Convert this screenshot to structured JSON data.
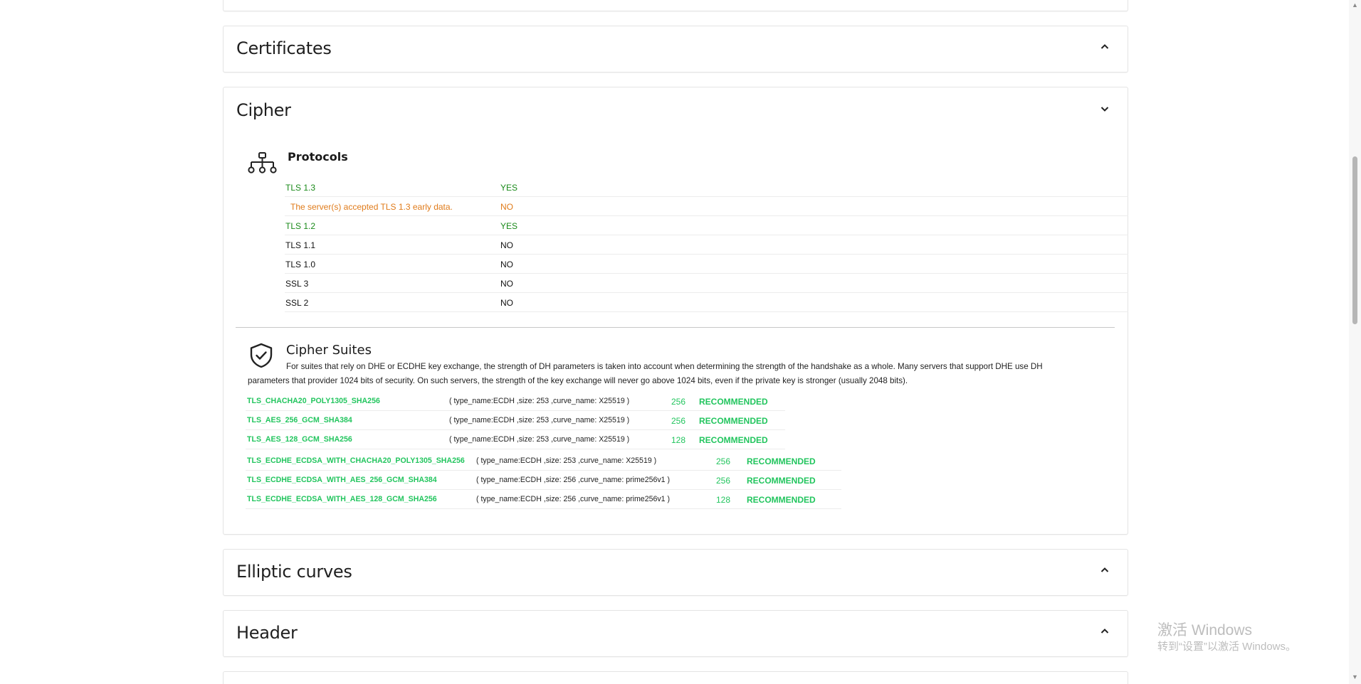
{
  "sections": {
    "certificates": {
      "title": "Certificates"
    },
    "cipher": {
      "title": "Cipher"
    },
    "elliptic_curves": {
      "title": "Elliptic curves"
    },
    "header": {
      "title": "Header"
    }
  },
  "protocols": {
    "title": "Protocols",
    "rows": [
      {
        "name": "TLS 1.3",
        "value": "YES",
        "color": "#1a8a1a"
      },
      {
        "name": "The server(s) accepted TLS 1.3 early data.",
        "value": "NO",
        "color": "#e07b1a"
      },
      {
        "name": "TLS 1.2",
        "value": "YES",
        "color": "#1a8a1a"
      },
      {
        "name": "TLS 1.1",
        "value": "NO",
        "color": "#111111"
      },
      {
        "name": "TLS 1.0",
        "value": "NO",
        "color": "#111111"
      },
      {
        "name": "SSL 3",
        "value": "NO",
        "color": "#111111"
      },
      {
        "name": "SSL 2",
        "value": "NO",
        "color": "#111111"
      }
    ]
  },
  "cipher_suites": {
    "title": "Cipher Suites",
    "description_line1": "For suites that rely on DHE or ECDHE key exchange, the strength of DH parameters is taken into account when determining the strength of the handshake as a whole. Many servers that support DHE use DH",
    "description_line2": "parameters that provider 1024 bits of security. On such servers, the strength of the key exchange will never go above 1024 bits, even if the private key is stronger (usually 2048 bits).",
    "tls13_rows": [
      {
        "name": "TLS_CHACHA20_POLY1305_SHA256",
        "kex": "( type_name:ECDH ,size: 253 ,curve_name: X25519 )",
        "bits": "256",
        "status": "RECOMMENDED"
      },
      {
        "name": "TLS_AES_256_GCM_SHA384",
        "kex": "( type_name:ECDH ,size: 253 ,curve_name: X25519 )",
        "bits": "256",
        "status": "RECOMMENDED"
      },
      {
        "name": "TLS_AES_128_GCM_SHA256",
        "kex": "( type_name:ECDH ,size: 253 ,curve_name: X25519 )",
        "bits": "128",
        "status": "RECOMMENDED"
      }
    ],
    "tls12_rows": [
      {
        "name": "TLS_ECDHE_ECDSA_WITH_CHACHA20_POLY1305_SHA256",
        "kex": "( type_name:ECDH ,size: 253 ,curve_name: X25519 )",
        "bits": "256",
        "status": "RECOMMENDED"
      },
      {
        "name": "TLS_ECDHE_ECDSA_WITH_AES_256_GCM_SHA384",
        "kex": "( type_name:ECDH ,size: 256 ,curve_name: prime256v1 )",
        "bits": "256",
        "status": "RECOMMENDED"
      },
      {
        "name": "TLS_ECDHE_ECDSA_WITH_AES_128_GCM_SHA256",
        "kex": "( type_name:ECDH ,size: 256 ,curve_name: prime256v1 )",
        "bits": "128",
        "status": "RECOMMENDED"
      }
    ]
  },
  "watermark": {
    "line1": "激活 Windows",
    "line2": "转到“设置”以激活 Windows。"
  }
}
